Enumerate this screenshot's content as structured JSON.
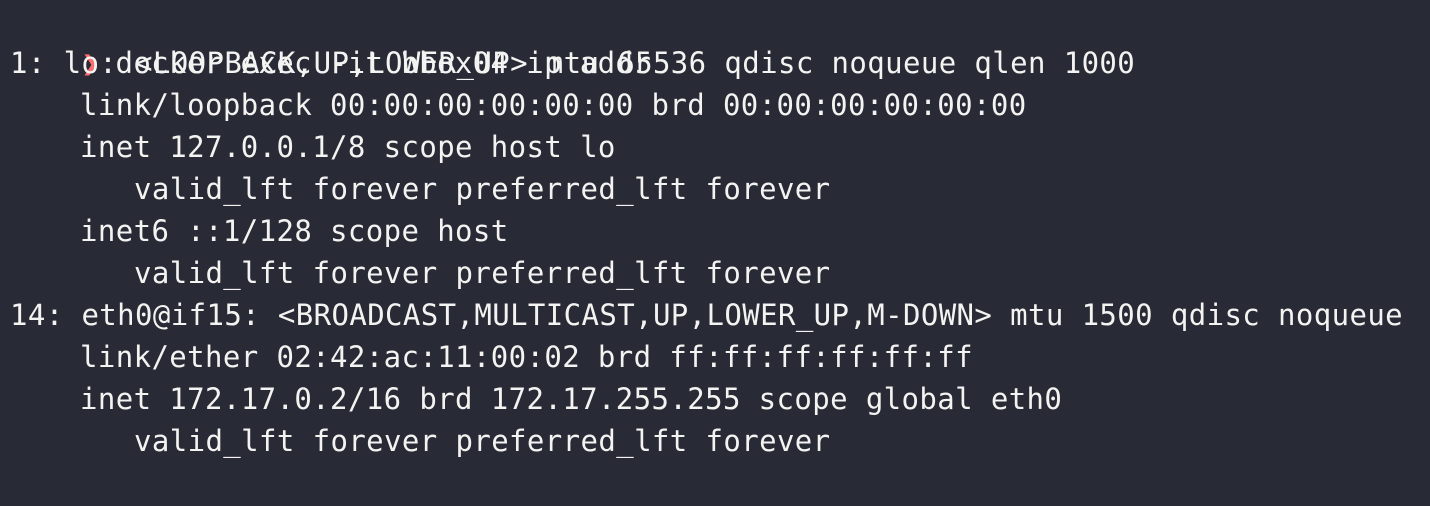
{
  "terminal": {
    "prompt_symbol": "❯",
    "command": "docker exec -it bbox04 ip addr",
    "output": [
      "1: lo: <LOOPBACK,UP,LOWER_UP> mtu 65536 qdisc noqueue qlen 1000",
      "link/loopback 00:00:00:00:00:00 brd 00:00:00:00:00:00",
      "inet 127.0.0.1/8 scope host lo",
      "valid_lft forever preferred_lft forever",
      "inet6 ::1/128 scope host",
      "valid_lft forever preferred_lft forever",
      "14: eth0@if15: <BROADCAST,MULTICAST,UP,LOWER_UP,M-DOWN> mtu 1500 qdisc noqueue",
      "link/ether 02:42:ac:11:00:02 brd ff:ff:ff:ff:ff:ff",
      "inet 172.17.0.2/16 brd 172.17.255.255 scope global eth0",
      "valid_lft forever preferred_lft forever"
    ]
  },
  "colors": {
    "background": "#282a36",
    "foreground": "#f3f3f1",
    "prompt": "#ff6e6e"
  }
}
